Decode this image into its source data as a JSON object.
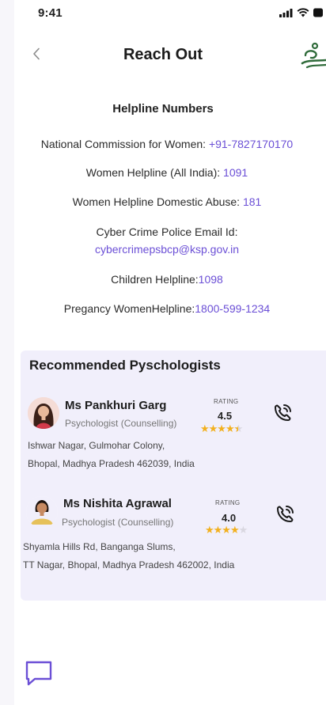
{
  "status": {
    "time": "9:41"
  },
  "header": {
    "title": "Reach Out"
  },
  "helplines": {
    "title": "Helpline Numbers",
    "items": [
      {
        "label": "National Commission for Women: ",
        "value": "+91-7827170170"
      },
      {
        "label": "Women Helpline (All India): ",
        "value": "1091"
      },
      {
        "label": "Women Helpline Domestic Abuse: ",
        "value": "181"
      },
      {
        "label": "Cyber Crime Police Email Id:",
        "value": "cybercrimepsbcp@ksp.gov.in"
      },
      {
        "label": "Children Helpline:",
        "value": "1098"
      },
      {
        "label": "Pregancy WomenHelpline:",
        "value": "1800-599-1234"
      }
    ]
  },
  "psychologists": {
    "title": "Recommended Pyschologists",
    "rating_label": "RATING",
    "items": [
      {
        "name": "Ms Pankhuri Garg",
        "role": "Psychologist (Counselling)",
        "rating": "4.5",
        "rating_value": 4.5,
        "address_line1": "Ishwar Nagar, Gulmohar Colony,",
        "address_line2": "Bhopal, Madhya Pradesh 462039, India"
      },
      {
        "name": "Ms Nishita Agrawal",
        "role": "Psychologist (Counselling)",
        "rating": "4.0",
        "rating_value": 4.0,
        "address_line1": "Shyamla Hills Rd, Banganga Slums,",
        "address_line2": "TT Nagar, Bhopal, Madhya Pradesh 462002, India"
      }
    ]
  },
  "colors": {
    "accent": "#6b4fd6",
    "card_bg": "#f1effb",
    "star": "#f2b01e",
    "logo": "#2f6b3a"
  },
  "icons": [
    "back-chevron-icon",
    "signal-icon",
    "wifi-icon",
    "battery-icon",
    "logo-icon",
    "phone-call-icon",
    "chat-icon"
  ]
}
